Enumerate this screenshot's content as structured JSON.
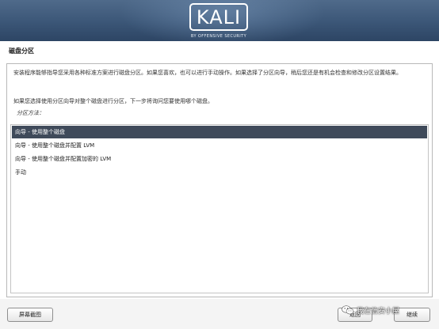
{
  "header": {
    "logo_text": "KALI",
    "logo_subtitle": "BY OFFENSIVE SECURITY"
  },
  "page": {
    "title": "磁盘分区"
  },
  "content": {
    "paragraph1": "安装程序能够指导您采用各种标准方案进行磁盘分区。如果您喜欢，也可以进行手动操作。如果选择了分区向导，稍后您还是有机会检查和修改分区设置结果。",
    "paragraph2": "如果您选择使用分区向导对整个磁盘进行分区，下一步将询问您要使用哪个磁盘。",
    "method_label": "分区方法：",
    "options": [
      {
        "label": "向导 - 使用整个磁盘",
        "selected": true
      },
      {
        "label": "向导 - 使用整个磁盘并配置 LVM",
        "selected": false
      },
      {
        "label": "向导 - 使用整个磁盘并配置加密的 LVM",
        "selected": false
      },
      {
        "label": "手动",
        "selected": false
      }
    ]
  },
  "footer": {
    "screenshot_button": "屏幕截图",
    "back_button": "返回",
    "continue_button": "继续"
  },
  "watermark": {
    "text": "我在信安小屋",
    "icon": "wechat-icon"
  },
  "colors": {
    "banner": "#3b5677",
    "selected_row": "#3f4a5a"
  }
}
